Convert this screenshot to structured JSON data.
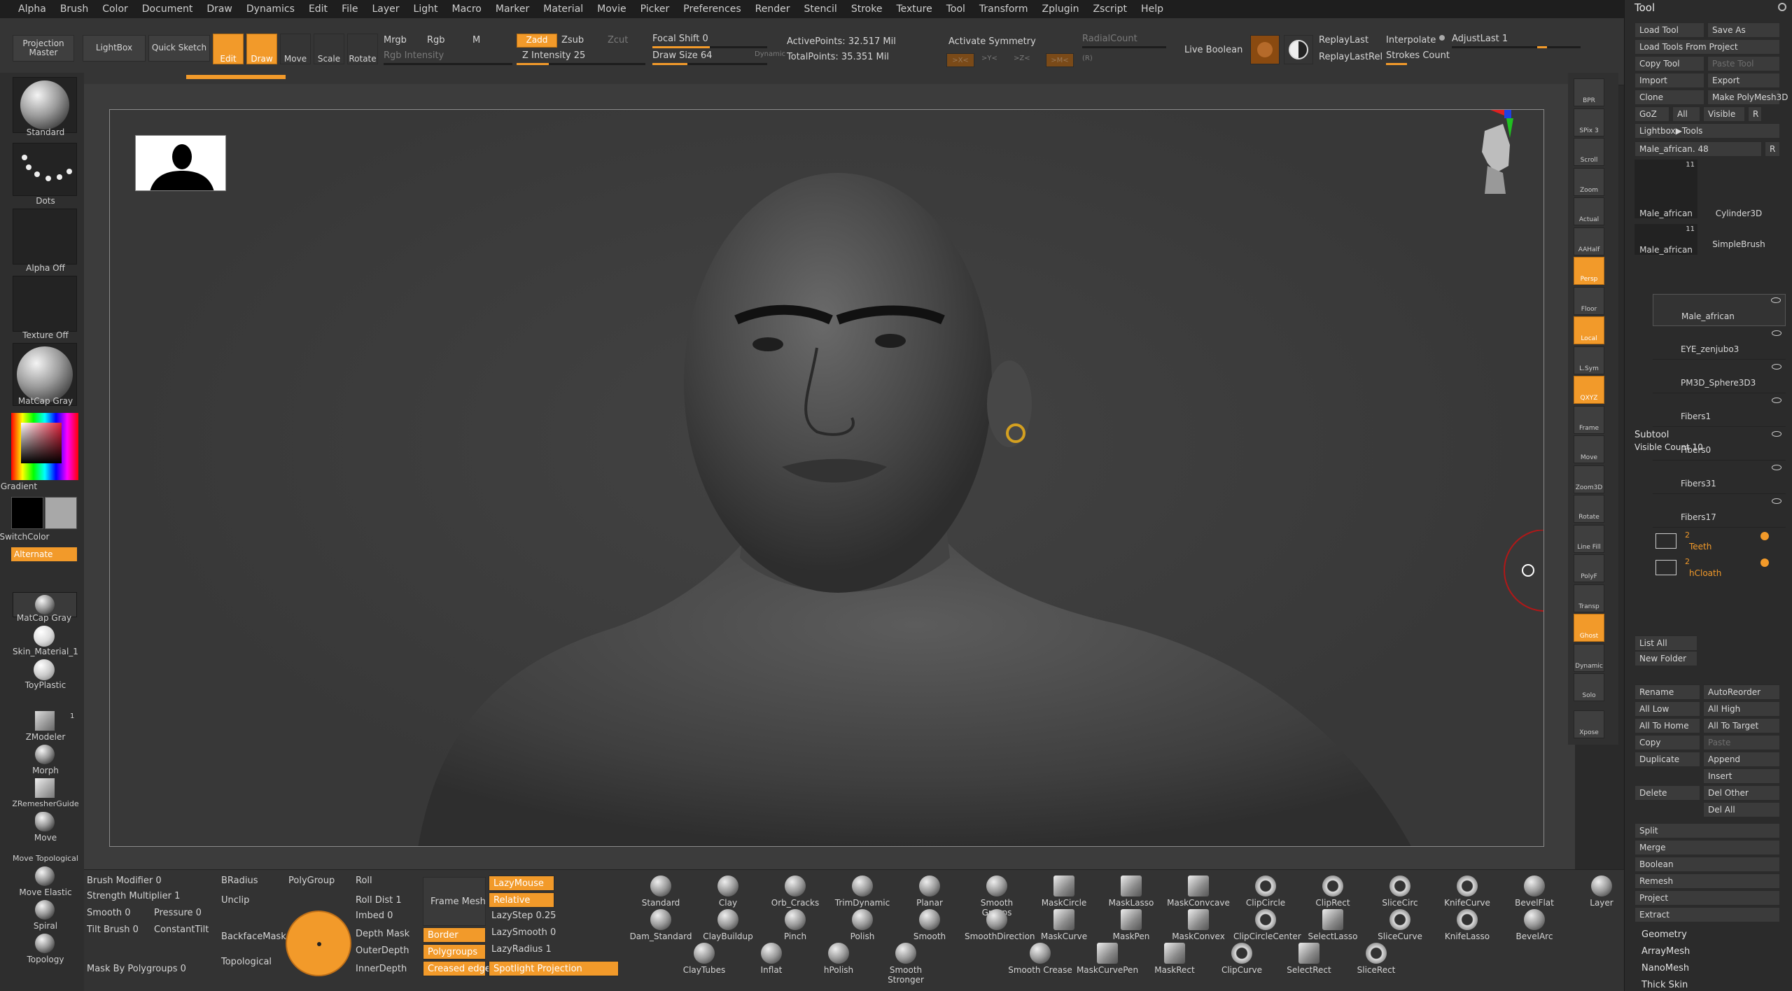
{
  "menu": [
    "Alpha",
    "Brush",
    "Color",
    "Document",
    "Draw",
    "Dynamics",
    "Edit",
    "File",
    "Layer",
    "Light",
    "Macro",
    "Marker",
    "Material",
    "Movie",
    "Picker",
    "Preferences",
    "Render",
    "Stencil",
    "Stroke",
    "Texture",
    "Tool",
    "Transform",
    "Zplugin",
    "Zscript",
    "Help"
  ],
  "topbar": {
    "projection_master": "Projection Master",
    "lightbox": "LightBox",
    "quick_sketch": "Quick Sketch",
    "edit": "Edit",
    "draw": "Draw",
    "move": "Move",
    "scale": "Scale",
    "rotate": "Rotate",
    "mrgb": "Mrgb",
    "rgb": "Rgb",
    "m": "M",
    "rgb_intensity": "Rgb Intensity",
    "zadd": "Zadd",
    "zsub": "Zsub",
    "zcut": "Zcut",
    "z_intensity": "Z Intensity 25",
    "focal_shift": "Focal Shift 0",
    "draw_size": "Draw Size 64",
    "dynamic": "Dynamic",
    "active_points": "ActivePoints: 32.517 Mil",
    "total_points": "TotalPoints: 35.351 Mil",
    "activate_symmetry": "Activate Symmetry",
    "radial_count": "RadialCount",
    "sym_x": ">X<",
    "sym_y": ">Y<",
    "sym_z": ">Z<",
    "sym_m": ">M<",
    "sym_r": "(R)",
    "live_boolean": "Live Boolean",
    "replay_last": "ReplayLast",
    "replay_last_rel": "ReplayLastRel",
    "interpolate": "Interpolate",
    "strokes_count": "Strokes Count",
    "adjust_last": "AdjustLast 1"
  },
  "leftshelf": {
    "brush": "Standard",
    "stroke": "Dots",
    "alpha": "Alpha Off",
    "texture": "Texture Off",
    "material": "MatCap Gray",
    "gradient": "Gradient",
    "switch_color": "SwitchColor",
    "alternate": "Alternate",
    "materials": [
      "MatCap Gray",
      "Skin_Material_1",
      "ToyPlastic"
    ],
    "tools": [
      "ZModeler",
      "Morph",
      "ZRemesherGuide",
      "Move",
      "Move Topological",
      "Move Elastic",
      "Spiral",
      "Topology"
    ],
    "zmodeler_count": "1"
  },
  "rightshelf": [
    "BPR",
    "SPix 3",
    "Scroll",
    "Zoom",
    "Actual",
    "AAHalf",
    "Persp",
    "Floor",
    "Local",
    "L.Sym",
    "QXYZ",
    "Frame",
    "Move",
    "Zoom3D",
    "Rotate",
    "Line Fill",
    "PolyF",
    "Transp",
    "Ghost",
    "Dynamic",
    "Solo",
    "Xpose"
  ],
  "toolpanel": {
    "title": "Tool",
    "buttons": [
      [
        "Load Tool",
        "Save As"
      ],
      [
        "Load Tools From Project"
      ],
      [
        "Copy Tool",
        "Paste Tool"
      ],
      [
        "Import",
        "Export"
      ],
      [
        "Clone",
        "Make PolyMesh3D"
      ],
      [
        "GoZ",
        "All",
        "Visible",
        "R"
      ],
      [
        "Lightbox▶Tools"
      ]
    ],
    "current_tool": "Male_african. 48",
    "tool_r": "R",
    "thumbs": [
      {
        "name": "Male_african",
        "count": "11"
      },
      {
        "name": "Cylinder3D",
        "count": ""
      },
      {
        "name": "SimpleBrush",
        "count": ""
      },
      {
        "name": "Male_african",
        "count": "11"
      }
    ],
    "subtool_title": "Subtool",
    "visible_count": "Visible Count 10",
    "subtools": [
      "Male_african",
      "EYE_zenjubo3",
      "PM3D_Sphere3D3",
      "Fibers1",
      "Fibers0",
      "Fibers31",
      "Fibers17"
    ],
    "folders": [
      {
        "name": "Teeth",
        "count": "2"
      },
      {
        "name": "hCloath",
        "count": "2"
      }
    ],
    "list_all": "List All",
    "new_folder": "New Folder",
    "actions": [
      [
        "Rename",
        "AutoReorder"
      ],
      [
        "All Low",
        "All High"
      ],
      [
        "All To Home",
        "All To Target"
      ],
      [
        "Copy",
        "Paste"
      ],
      [
        "Duplicate",
        "Append"
      ],
      [
        "",
        "Insert"
      ],
      [
        "Delete",
        "Del Other"
      ],
      [
        "",
        "Del All"
      ]
    ],
    "single": [
      "Split",
      "Merge",
      "Boolean",
      "Remesh",
      "Project",
      "Extract"
    ],
    "sections": [
      "Geometry",
      "ArrayMesh",
      "NanoMesh",
      "Thick Skin"
    ]
  },
  "bottombar": {
    "brush_modifier": "Brush Modifier 0",
    "strength_multiplier": "Strength Multiplier 1",
    "smooth": "Smooth 0",
    "pressure": "Pressure 0",
    "tilt_brush": "Tilt Brush 0",
    "constant_tilt": "ConstantTilt",
    "mask_by_polygroups": "Mask By Polygroups 0",
    "bradius": "BRadius",
    "unclip": "Unclip",
    "backface_mask": "BackfaceMask",
    "topological": "Topological",
    "polygroup": "PolyGroup",
    "roll": "Roll",
    "roll_dist": "Roll Dist 1",
    "imbed": "Imbed 0",
    "depth_mask": "Depth Mask",
    "outer_depth": "OuterDepth",
    "inner_depth": "InnerDepth",
    "frame_mesh": "Frame Mesh",
    "border": "Border",
    "polygroups": "Polygroups",
    "creased_edges": "Creased edges",
    "lazy_mouse": "LazyMouse",
    "relative": "Relative",
    "lazy_step": "LazyStep 0.25",
    "lazy_smooth": "LazySmooth 0",
    "lazy_radius": "LazyRadius 1",
    "spotlight_projection": "Spotlight Projection",
    "brushes_row1": [
      "Standard",
      "Clay",
      "Orb_Cracks",
      "TrimDynamic",
      "Planar",
      "Smooth Groups",
      "MaskCircle",
      "MaskLasso",
      "MaskConvcave",
      "ClipCircle",
      "ClipRect",
      "SliceCirc",
      "KnifeCurve",
      "BevelFlat",
      "Layer"
    ],
    "brushes_row2": [
      "Dam_Standard",
      "ClayBuildup",
      "Pinch",
      "Polish",
      "Smooth",
      "SmoothDirection",
      "MaskCurve",
      "MaskPen",
      "MaskConvex",
      "ClipCircleCenter",
      "SelectLasso",
      "SliceCurve",
      "KnifeLasso",
      "BevelArc"
    ],
    "brushes_row3": [
      "ClayTubes",
      "Inflat",
      "hPolish",
      "Smooth Stronger",
      "Smooth Crease",
      "MaskCurvePen",
      "MaskRect",
      "ClipCurve",
      "SelectRect",
      "SliceRect"
    ]
  }
}
